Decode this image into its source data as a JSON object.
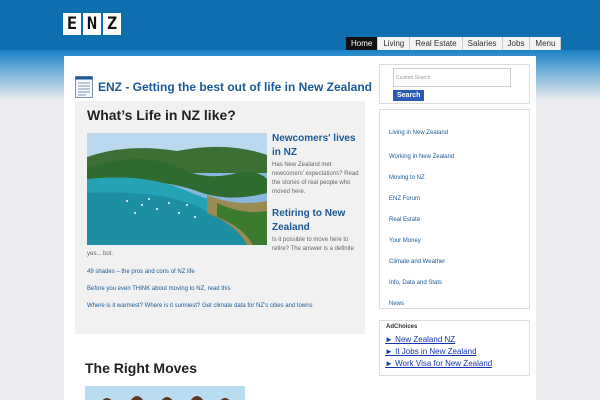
{
  "logo": {
    "letters": [
      "E",
      "N",
      "Z"
    ]
  },
  "nav": {
    "items": [
      "Home",
      "Living",
      "Real Estate",
      "Salaries",
      "Jobs",
      "Menu"
    ]
  },
  "main": {
    "site_title": "ENZ - Getting the best out of life in New Zealand",
    "section_title": "What’s Life in NZ like?",
    "feature1": {
      "title": "Newcomers' lives in NZ",
      "text": "Has New Zealand met newcomers' expectations? Read the stories of real people who moved here."
    },
    "feature2": {
      "title": "Retiring to New Zealand",
      "text": "Is it possible to move here to retire? The answer is a definite"
    },
    "continuation": "yes... but.",
    "links": [
      "49 shades – the pros and cons of NZ life",
      "Before you even THINK about moving to NZ, read this",
      "Where is it warmest? Where is it sunniest? Get climate data for NZ's cities and towns"
    ],
    "moves_title": "The Right Moves"
  },
  "sidebar": {
    "search_placeholder": "Custom Search",
    "search_button": "Search",
    "menu": [
      "Living in New Zealand",
      "Working in New Zealand",
      "Moving to NZ",
      "ENZ Forum",
      "Real Estate",
      "Your Money",
      "Climate and Weather",
      "Info, Data and Stats",
      "News"
    ],
    "ads_label": "AdChoices",
    "ads": [
      "► New Zealand NZ",
      "► It Jobs in New Zealand",
      "► Work Visa for New Zealand"
    ]
  }
}
